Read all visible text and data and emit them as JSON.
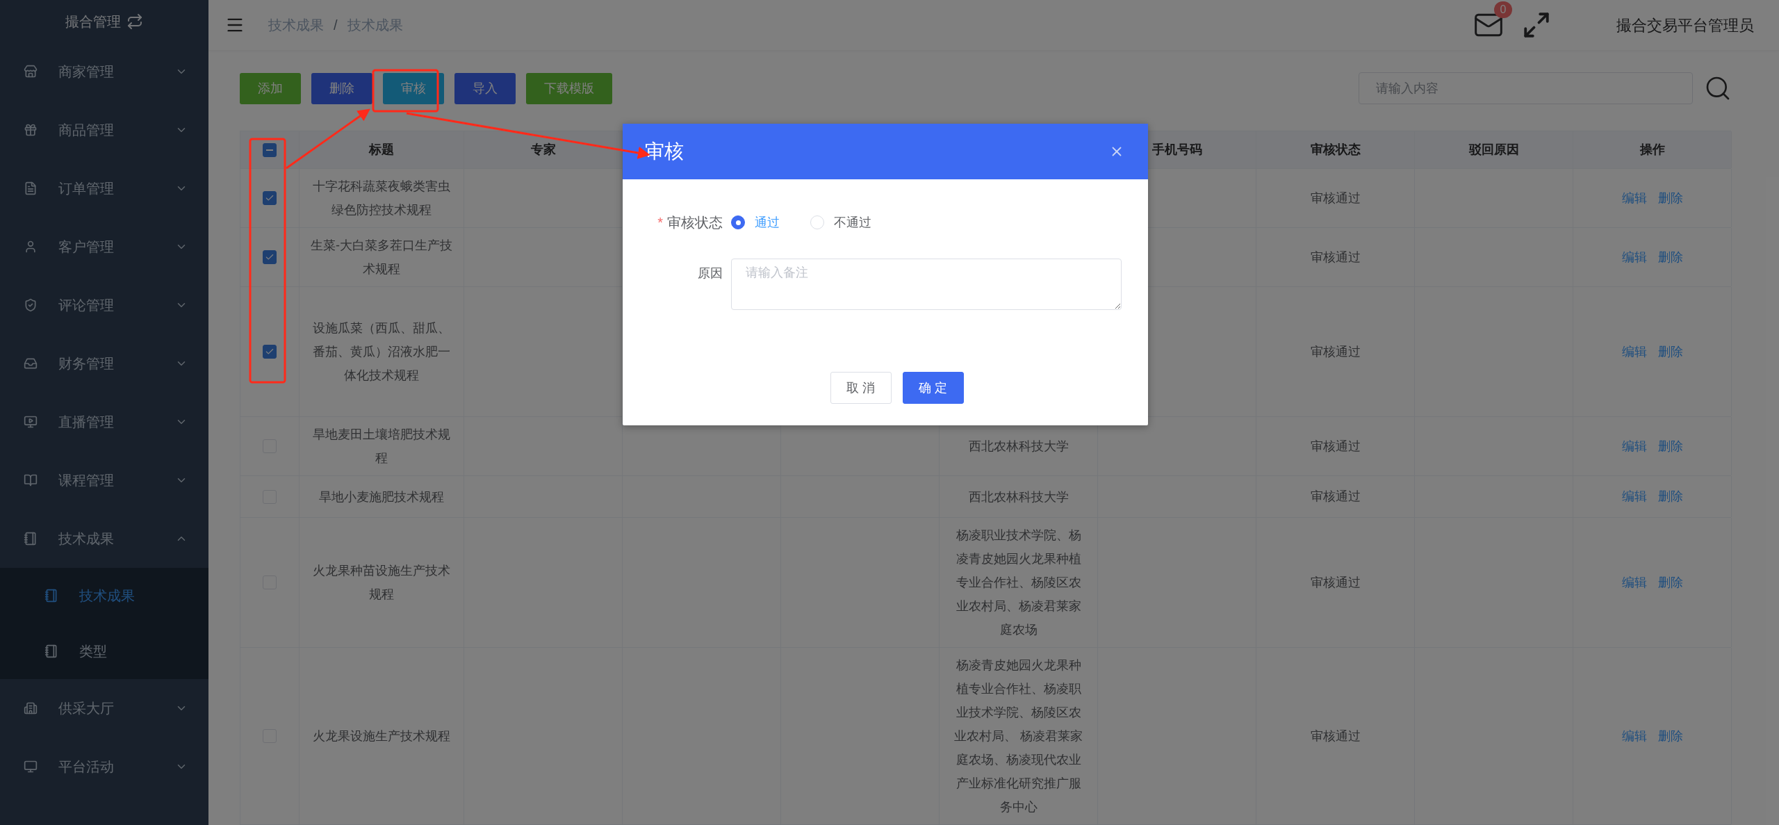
{
  "sidebar": {
    "title": "撮合管理",
    "items": [
      {
        "label": "商家管理",
        "expanded": false
      },
      {
        "label": "商品管理",
        "expanded": false
      },
      {
        "label": "订单管理",
        "expanded": false
      },
      {
        "label": "客户管理",
        "expanded": false
      },
      {
        "label": "评论管理",
        "expanded": false
      },
      {
        "label": "财务管理",
        "expanded": false
      },
      {
        "label": "直播管理",
        "expanded": false
      },
      {
        "label": "课程管理",
        "expanded": false
      },
      {
        "label": "技术成果",
        "expanded": true,
        "children": [
          {
            "label": "技术成果",
            "selected": true
          },
          {
            "label": "类型",
            "selected": false
          }
        ]
      },
      {
        "label": "供采大厅",
        "expanded": false
      },
      {
        "label": "平台活动",
        "expanded": false
      }
    ]
  },
  "topbar": {
    "breadcrumb": [
      "技术成果",
      "技术成果"
    ],
    "separator": "/",
    "unread_count": "0",
    "user_name": "撮合交易平台管理员"
  },
  "toolbar": {
    "buttons": [
      {
        "label": "添加",
        "kind": "success"
      },
      {
        "label": "删除",
        "kind": "primary"
      },
      {
        "label": "审核",
        "kind": "info"
      },
      {
        "label": "导入",
        "kind": "primary"
      },
      {
        "label": "下载模版",
        "kind": "success"
      }
    ],
    "search": {
      "placeholder": "请输入内容"
    }
  },
  "table": {
    "select_all_indeterminate": true,
    "columns": [
      "标题",
      "专家",
      null,
      null,
      null,
      "手机号码",
      "审核状态",
      "驳回原因",
      "操作"
    ],
    "rows": [
      {
        "selected": true,
        "title": "十字花科蔬菜夜蛾类害虫绿色防控技术规程",
        "status": "审核通过",
        "actions": [
          "编辑",
          "删除"
        ]
      },
      {
        "selected": true,
        "title": "生菜-大白菜多茬口生产技术规程",
        "status": "审核通过",
        "actions": [
          "编辑",
          "删除"
        ]
      },
      {
        "selected": true,
        "title": "设施瓜菜（西瓜、甜瓜、番茄、黄瓜）沼液水肥一体化技术规程",
        "status": "审核通过",
        "actions": [
          "编辑",
          "删除"
        ]
      },
      {
        "selected": false,
        "title": "旱地麦田土壤培肥技术规程",
        "unit": "西北农林科技大学",
        "status": "审核通过",
        "actions": [
          "编辑",
          "删除"
        ]
      },
      {
        "selected": false,
        "title": "旱地小麦施肥技术规程",
        "unit": "西北农林科技大学",
        "status": "审核通过",
        "actions": [
          "编辑",
          "删除"
        ]
      },
      {
        "selected": false,
        "title": "火龙果种苗设施生产技术规程",
        "unit": "杨凌职业技术学院、杨凌青皮她园火龙果种植专业合作社、杨陵区农业农村局、杨凌君莱家庭农场",
        "status": "审核通过",
        "actions": [
          "编辑",
          "删除"
        ]
      },
      {
        "selected": false,
        "title": "火龙果设施生产技术规程",
        "unit": "杨凌青皮她园火龙果种植专业合作社、杨凌职业技术学院、杨陵区农业农村局、 杨凌君莱家庭农场、杨凌现代农业产业标准化研究推广服务中心",
        "status": "审核通过",
        "actions": [
          "编辑",
          "删除"
        ]
      }
    ]
  },
  "dialog": {
    "title": "审核",
    "status_label": "审核状态",
    "required_mark": "*",
    "options": [
      {
        "label": "通过",
        "selected": true
      },
      {
        "label": "不通过",
        "selected": false
      }
    ],
    "reason_label": "原因",
    "reason_placeholder": "请输入备注",
    "buttons": [
      {
        "label": "取 消",
        "kind": "default"
      },
      {
        "label": "确 定",
        "kind": "primary"
      }
    ]
  }
}
